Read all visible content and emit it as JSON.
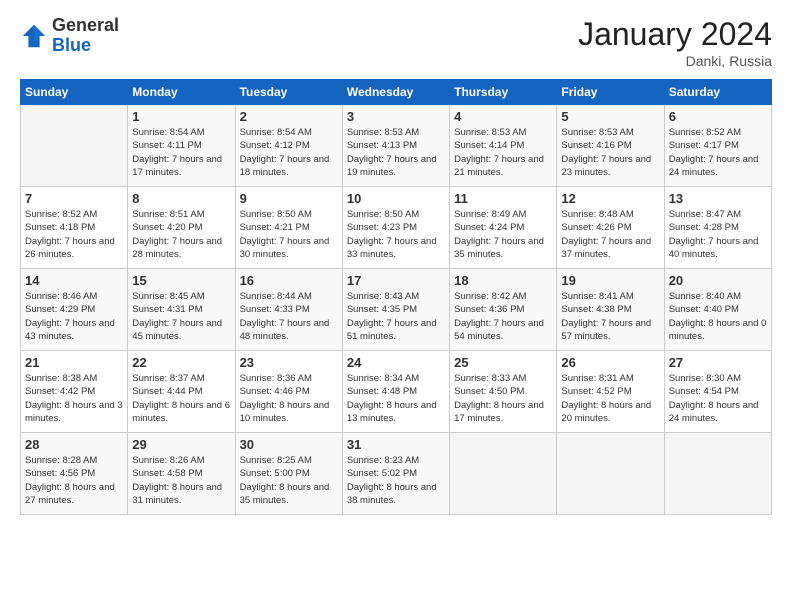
{
  "header": {
    "logo_general": "General",
    "logo_blue": "Blue",
    "month_year": "January 2024",
    "location": "Danki, Russia"
  },
  "days_of_week": [
    "Sunday",
    "Monday",
    "Tuesday",
    "Wednesday",
    "Thursday",
    "Friday",
    "Saturday"
  ],
  "weeks": [
    [
      {
        "num": "",
        "empty": true
      },
      {
        "num": "1",
        "sunrise": "Sunrise: 8:54 AM",
        "sunset": "Sunset: 4:11 PM",
        "daylight": "Daylight: 7 hours and 17 minutes."
      },
      {
        "num": "2",
        "sunrise": "Sunrise: 8:54 AM",
        "sunset": "Sunset: 4:12 PM",
        "daylight": "Daylight: 7 hours and 18 minutes."
      },
      {
        "num": "3",
        "sunrise": "Sunrise: 8:53 AM",
        "sunset": "Sunset: 4:13 PM",
        "daylight": "Daylight: 7 hours and 19 minutes."
      },
      {
        "num": "4",
        "sunrise": "Sunrise: 8:53 AM",
        "sunset": "Sunset: 4:14 PM",
        "daylight": "Daylight: 7 hours and 21 minutes."
      },
      {
        "num": "5",
        "sunrise": "Sunrise: 8:53 AM",
        "sunset": "Sunset: 4:16 PM",
        "daylight": "Daylight: 7 hours and 23 minutes."
      },
      {
        "num": "6",
        "sunrise": "Sunrise: 8:52 AM",
        "sunset": "Sunset: 4:17 PM",
        "daylight": "Daylight: 7 hours and 24 minutes."
      }
    ],
    [
      {
        "num": "7",
        "sunrise": "Sunrise: 8:52 AM",
        "sunset": "Sunset: 4:18 PM",
        "daylight": "Daylight: 7 hours and 26 minutes."
      },
      {
        "num": "8",
        "sunrise": "Sunrise: 8:51 AM",
        "sunset": "Sunset: 4:20 PM",
        "daylight": "Daylight: 7 hours and 28 minutes."
      },
      {
        "num": "9",
        "sunrise": "Sunrise: 8:50 AM",
        "sunset": "Sunset: 4:21 PM",
        "daylight": "Daylight: 7 hours and 30 minutes."
      },
      {
        "num": "10",
        "sunrise": "Sunrise: 8:50 AM",
        "sunset": "Sunset: 4:23 PM",
        "daylight": "Daylight: 7 hours and 33 minutes."
      },
      {
        "num": "11",
        "sunrise": "Sunrise: 8:49 AM",
        "sunset": "Sunset: 4:24 PM",
        "daylight": "Daylight: 7 hours and 35 minutes."
      },
      {
        "num": "12",
        "sunrise": "Sunrise: 8:48 AM",
        "sunset": "Sunset: 4:26 PM",
        "daylight": "Daylight: 7 hours and 37 minutes."
      },
      {
        "num": "13",
        "sunrise": "Sunrise: 8:47 AM",
        "sunset": "Sunset: 4:28 PM",
        "daylight": "Daylight: 7 hours and 40 minutes."
      }
    ],
    [
      {
        "num": "14",
        "sunrise": "Sunrise: 8:46 AM",
        "sunset": "Sunset: 4:29 PM",
        "daylight": "Daylight: 7 hours and 43 minutes."
      },
      {
        "num": "15",
        "sunrise": "Sunrise: 8:45 AM",
        "sunset": "Sunset: 4:31 PM",
        "daylight": "Daylight: 7 hours and 45 minutes."
      },
      {
        "num": "16",
        "sunrise": "Sunrise: 8:44 AM",
        "sunset": "Sunset: 4:33 PM",
        "daylight": "Daylight: 7 hours and 48 minutes."
      },
      {
        "num": "17",
        "sunrise": "Sunrise: 8:43 AM",
        "sunset": "Sunset: 4:35 PM",
        "daylight": "Daylight: 7 hours and 51 minutes."
      },
      {
        "num": "18",
        "sunrise": "Sunrise: 8:42 AM",
        "sunset": "Sunset: 4:36 PM",
        "daylight": "Daylight: 7 hours and 54 minutes."
      },
      {
        "num": "19",
        "sunrise": "Sunrise: 8:41 AM",
        "sunset": "Sunset: 4:38 PM",
        "daylight": "Daylight: 7 hours and 57 minutes."
      },
      {
        "num": "20",
        "sunrise": "Sunrise: 8:40 AM",
        "sunset": "Sunset: 4:40 PM",
        "daylight": "Daylight: 8 hours and 0 minutes."
      }
    ],
    [
      {
        "num": "21",
        "sunrise": "Sunrise: 8:38 AM",
        "sunset": "Sunset: 4:42 PM",
        "daylight": "Daylight: 8 hours and 3 minutes."
      },
      {
        "num": "22",
        "sunrise": "Sunrise: 8:37 AM",
        "sunset": "Sunset: 4:44 PM",
        "daylight": "Daylight: 8 hours and 6 minutes."
      },
      {
        "num": "23",
        "sunrise": "Sunrise: 8:36 AM",
        "sunset": "Sunset: 4:46 PM",
        "daylight": "Daylight: 8 hours and 10 minutes."
      },
      {
        "num": "24",
        "sunrise": "Sunrise: 8:34 AM",
        "sunset": "Sunset: 4:48 PM",
        "daylight": "Daylight: 8 hours and 13 minutes."
      },
      {
        "num": "25",
        "sunrise": "Sunrise: 8:33 AM",
        "sunset": "Sunset: 4:50 PM",
        "daylight": "Daylight: 8 hours and 17 minutes."
      },
      {
        "num": "26",
        "sunrise": "Sunrise: 8:31 AM",
        "sunset": "Sunset: 4:52 PM",
        "daylight": "Daylight: 8 hours and 20 minutes."
      },
      {
        "num": "27",
        "sunrise": "Sunrise: 8:30 AM",
        "sunset": "Sunset: 4:54 PM",
        "daylight": "Daylight: 8 hours and 24 minutes."
      }
    ],
    [
      {
        "num": "28",
        "sunrise": "Sunrise: 8:28 AM",
        "sunset": "Sunset: 4:56 PM",
        "daylight": "Daylight: 8 hours and 27 minutes."
      },
      {
        "num": "29",
        "sunrise": "Sunrise: 8:26 AM",
        "sunset": "Sunset: 4:58 PM",
        "daylight": "Daylight: 8 hours and 31 minutes."
      },
      {
        "num": "30",
        "sunrise": "Sunrise: 8:25 AM",
        "sunset": "Sunset: 5:00 PM",
        "daylight": "Daylight: 8 hours and 35 minutes."
      },
      {
        "num": "31",
        "sunrise": "Sunrise: 8:23 AM",
        "sunset": "Sunset: 5:02 PM",
        "daylight": "Daylight: 8 hours and 38 minutes."
      },
      {
        "num": "",
        "empty": true
      },
      {
        "num": "",
        "empty": true
      },
      {
        "num": "",
        "empty": true
      }
    ]
  ]
}
